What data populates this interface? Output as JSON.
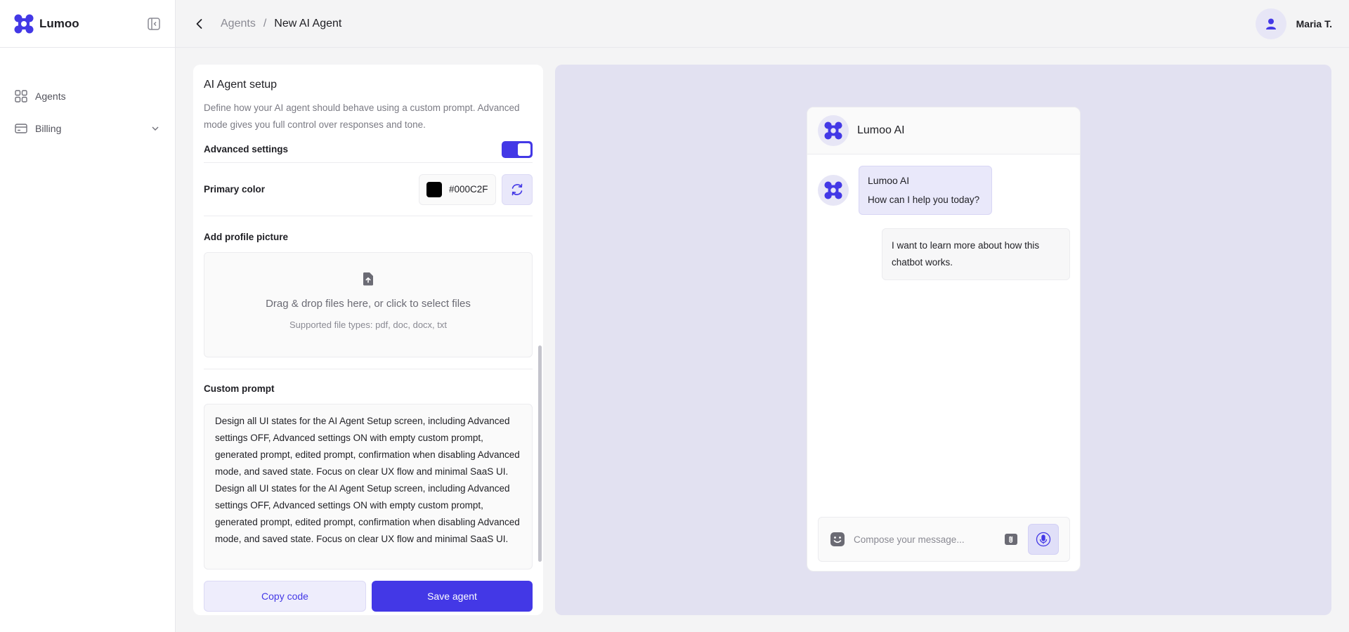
{
  "app": {
    "brand": "Lumoo"
  },
  "sidebar": {
    "items": [
      {
        "label": "Agents",
        "icon": "grid-icon"
      },
      {
        "label": "Billing",
        "icon": "card-icon",
        "has_submenu": true
      }
    ]
  },
  "header": {
    "breadcrumb_parent": "Agents",
    "breadcrumb_separator": "/",
    "breadcrumb_current": "New AI Agent",
    "user_name": "Maria T."
  },
  "setup": {
    "title": "AI Agent setup",
    "description": "Define how your AI agent should behave using a custom prompt. Advanced mode gives you full control over responses and tone.",
    "advanced_label": "Advanced settings",
    "advanced_on": true,
    "primary_color_label": "Primary color",
    "primary_color_value": "#000C2F",
    "profile_picture_label": "Add profile picture",
    "dropzone_main": "Drag & drop files here, or click to select files",
    "dropzone_sub": "Supported file types: pdf, doc, docx, txt",
    "custom_prompt_label": "Custom prompt",
    "custom_prompt_value": "Design all UI states for the AI Agent Setup screen, including Advanced settings OFF, Advanced settings ON with empty custom prompt, generated prompt, edited prompt, confirmation when disabling Advanced mode, and saved state. Focus on clear UX flow and minimal SaaS UI. Design all UI states for the AI Agent Setup screen, including Advanced settings OFF, Advanced settings ON with empty custom prompt, generated prompt, edited prompt, confirmation when disabling Advanced mode, and saved state. Focus on clear UX flow and minimal SaaS UI.",
    "copy_button": "Copy code",
    "save_button": "Save agent"
  },
  "preview": {
    "chat_title": "Lumoo AI",
    "bot_name": "Lumoo AI",
    "bot_message": "How can I help you today?",
    "user_message": "I want to learn more about how this chatbot works.",
    "composer_placeholder": "Compose your message..."
  },
  "colors": {
    "accent": "#4338E6",
    "accent_soft": "#E9E8FA",
    "preview_bg": "#E2E1F1",
    "page_bg": "#F4F4F5"
  }
}
